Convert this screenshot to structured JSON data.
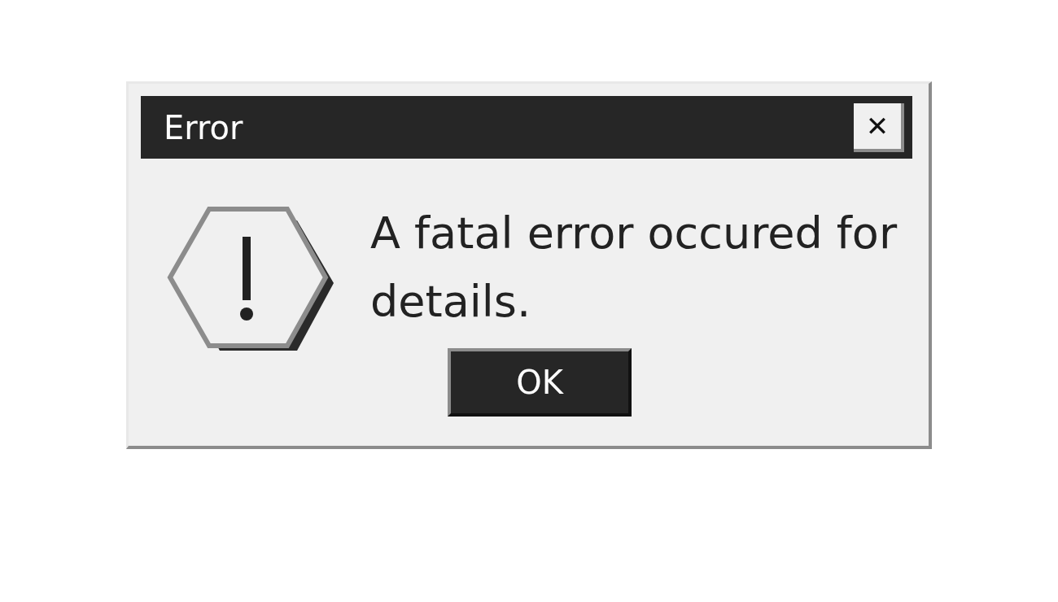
{
  "window": {
    "title": "Error",
    "close_label": "✕"
  },
  "message": "A fatal error occured for details.",
  "buttons": [
    "OK"
  ]
}
